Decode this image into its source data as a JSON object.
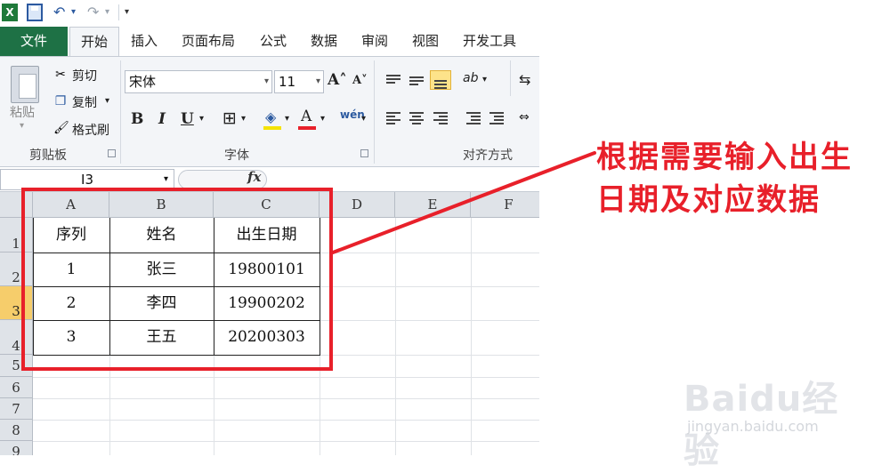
{
  "app": {
    "logo_text": "X",
    "qat": {
      "undo_icon": "↶",
      "undo_dd": "▾",
      "redo_icon": "↷",
      "redo_dd": "▾",
      "customize": "▾"
    }
  },
  "ribbon_tabs": [
    "文件",
    "开始",
    "插入",
    "页面布局",
    "公式",
    "数据",
    "审阅",
    "视图",
    "开发工具"
  ],
  "clipboard": {
    "paste": "粘贴",
    "cut": "剪切",
    "copy": "复制",
    "format_painter": "格式刷",
    "group": "剪贴板",
    "cut_icon": "✂",
    "copy_icon": "❐",
    "painter_icon": "🖌",
    "dd": "▾"
  },
  "font": {
    "name": "宋体",
    "size": "11",
    "group": "字体",
    "bold": "B",
    "italic": "I",
    "underline": "U",
    "grow": "A˄",
    "shrink": "A˅",
    "dd": "▾",
    "border_icon": "⊞",
    "fill_icon": "◈",
    "color_icon": "A",
    "phonetic": "wén",
    "fill_color": "#f5e300",
    "font_color": "#e8202a"
  },
  "alignment": {
    "group": "对齐方式",
    "orientation": "ab",
    "dd": "▾",
    "wrap_icon": "⇆",
    "merge_icon": "⇔"
  },
  "launcher_icon": "↘",
  "formula_bar": {
    "name_box": "I3",
    "dd": "▾",
    "fx": "fx"
  },
  "columns": [
    "A",
    "B",
    "C",
    "D",
    "E",
    "F"
  ],
  "rows": [
    "1",
    "2",
    "3",
    "4",
    "5",
    "6",
    "7",
    "8",
    "9"
  ],
  "table": {
    "headers": [
      "序列",
      "姓名",
      "出生日期"
    ],
    "rows": [
      [
        "1",
        "张三",
        "19800101"
      ],
      [
        "2",
        "李四",
        "19900202"
      ],
      [
        "3",
        "王五",
        "20200303"
      ]
    ]
  },
  "annotation": {
    "line1": "根据需要输入出生",
    "line2": "日期及对应数据",
    "color": "#e8202a"
  },
  "watermark": {
    "brand": "Baidu经验",
    "url": "jingyan.baidu.com"
  }
}
